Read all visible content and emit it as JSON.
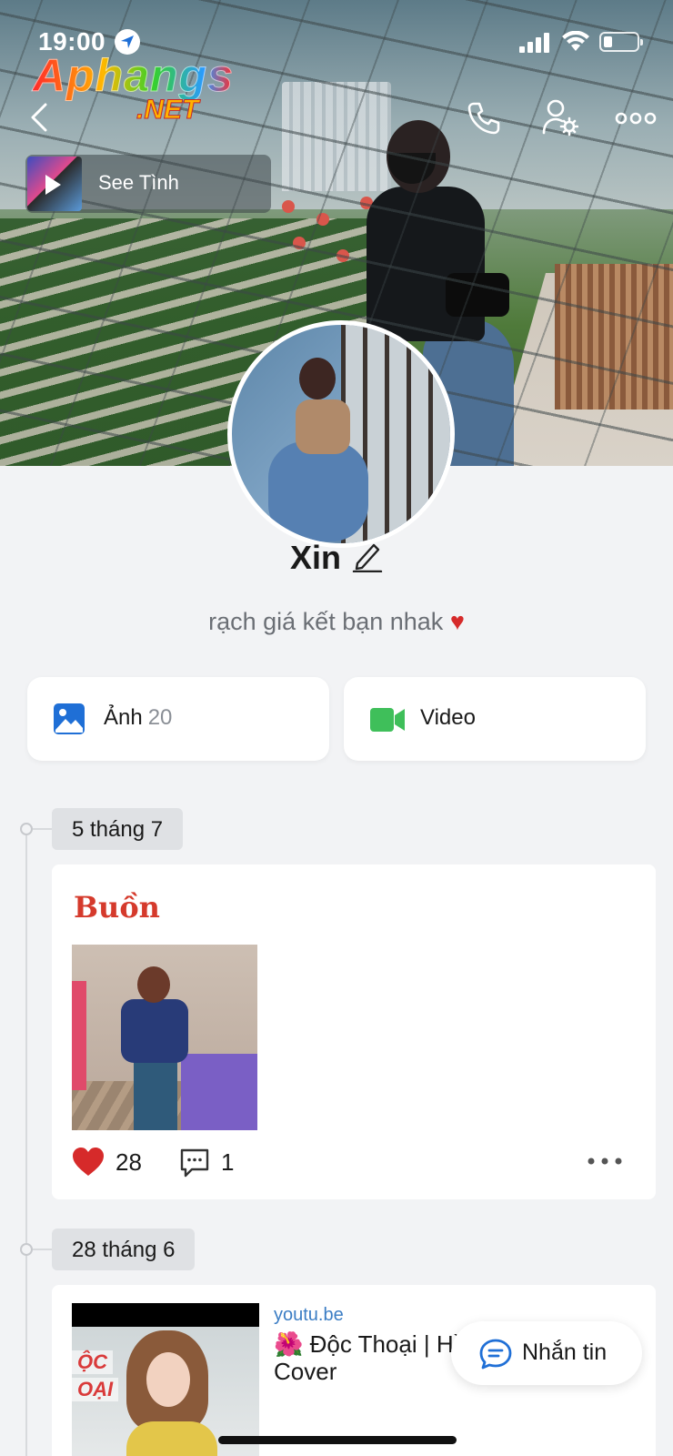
{
  "status_bar": {
    "time": "19:00"
  },
  "watermark": {
    "line1": "Aphangs",
    "line2": ".NET"
  },
  "music": {
    "title": "See Tình"
  },
  "profile": {
    "name": "Xin",
    "bio": "rạch giá kết bạn nhak",
    "bio_emoji": "♥"
  },
  "media": {
    "photos_label": "Ảnh",
    "photos_count": "20",
    "videos_label": "Video"
  },
  "timeline": [
    {
      "date": "5 tháng 7",
      "text": "Buồn",
      "likes": "28",
      "comments": "1"
    },
    {
      "date": "28 tháng 6",
      "link_domain": "youtu.be",
      "link_title": "🌺 Độc Thoại | Hồng Thuận | Vu Cover",
      "thumb_tag1": "ỘC",
      "thumb_tag2": "OẠI"
    }
  ],
  "message_button": {
    "label": "Nhắn tin"
  },
  "colors": {
    "post_text": "#d53a2c",
    "link": "#3b7dc4",
    "photo_icon": "#1f6fd6",
    "video_icon": "#3fbf5a"
  }
}
